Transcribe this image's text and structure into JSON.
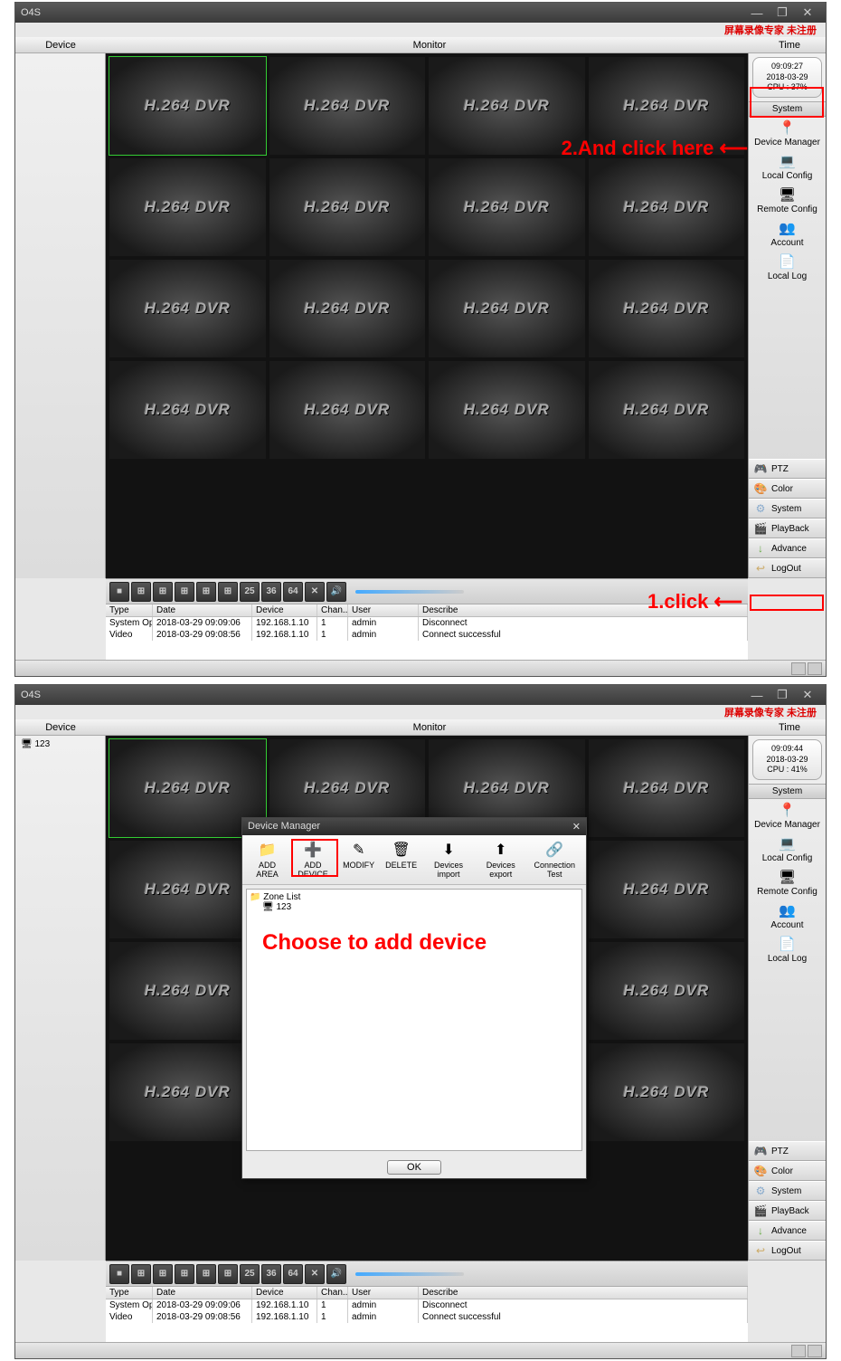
{
  "app_title": "O4S",
  "chinese_watermark": "屏幕录像专家 未注册",
  "header": {
    "device": "Device",
    "monitor": "Monitor",
    "time": "Time"
  },
  "win_buttons": {
    "min": "—",
    "max": "❐",
    "close": "✕"
  },
  "screen1": {
    "time_box": {
      "time": "09:09:27",
      "date": "2018-03-29",
      "cpu": "CPU : 37%"
    },
    "annotation1": "1.click",
    "arrow1": "⟵",
    "annotation2": "2.And click here",
    "arrow2": "⟵"
  },
  "screen2": {
    "time_box": {
      "time": "09:09:44",
      "date": "2018-03-29",
      "cpu": "CPU : 41%"
    },
    "device_tree": "123",
    "annotation": "Choose to add device"
  },
  "cell_label": "H.264 DVR",
  "grid_buttons": [
    "■",
    "⊞",
    "⊞",
    "⊞",
    "⊞",
    "⊞",
    "25",
    "36",
    "64",
    "✕",
    "🔊"
  ],
  "log": {
    "cols": [
      "Type",
      "Date",
      "Device",
      "Chan...",
      "User",
      "Describe"
    ],
    "rows": [
      [
        "System Oper...",
        "2018-03-29 09:09:06",
        "192.168.1.10",
        "1",
        "admin",
        "Disconnect"
      ],
      [
        "Video",
        "2018-03-29 09:08:56",
        "192.168.1.10",
        "1",
        "admin",
        "Connect successful"
      ]
    ]
  },
  "system_header": "System",
  "system_items": [
    {
      "icon": "📍",
      "label": "Device Manager"
    },
    {
      "icon": "💻",
      "label": "Local Config"
    },
    {
      "icon": "🖥",
      "label": "Remote Config"
    },
    {
      "icon": "👥",
      "label": "Account"
    },
    {
      "icon": "📄",
      "label": "Local Log"
    }
  ],
  "tabs": [
    {
      "icon": "🎮",
      "label": "PTZ",
      "color": "#c88"
    },
    {
      "icon": "🎨",
      "label": "Color",
      "color": "#8ac"
    },
    {
      "icon": "⚙",
      "label": "System",
      "color": "#8ac"
    },
    {
      "icon": "🎬",
      "label": "PlayBack",
      "color": "#c66"
    },
    {
      "icon": "↓",
      "label": "Advance",
      "color": "#6a4"
    },
    {
      "icon": "↩",
      "label": "LogOut",
      "color": "#ca6"
    }
  ],
  "dialog": {
    "title": "Device Manager",
    "close": "✕",
    "toolbar": [
      {
        "icon": "📁",
        "label": "ADD AREA"
      },
      {
        "icon": "➕",
        "label": "ADD DEVICE"
      },
      {
        "icon": "✎",
        "label": "MODIFY"
      },
      {
        "icon": "🗑",
        "label": "DELETE"
      },
      {
        "icon": "⬇",
        "label": "Devices import"
      },
      {
        "icon": "⬆",
        "label": "Devices export"
      },
      {
        "icon": "🔗",
        "label": "Connection Test"
      }
    ],
    "tree_root": "Zone List",
    "tree_item": "123",
    "ok": "OK"
  }
}
